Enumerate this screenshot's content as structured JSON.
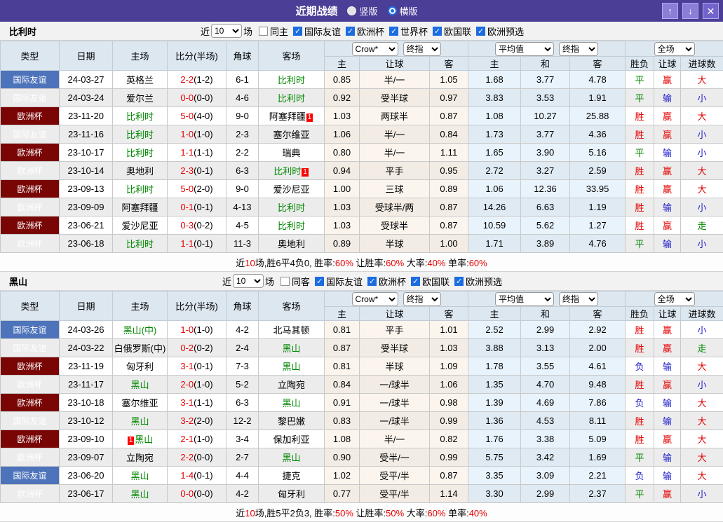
{
  "titlebar": {
    "title": "近期战绩",
    "radios": [
      {
        "label": "竖版",
        "selected": false
      },
      {
        "label": "横版",
        "selected": true
      }
    ],
    "buttons": {
      "up": "↑",
      "down": "↓",
      "close": "✕"
    }
  },
  "filter": {
    "near": "近",
    "count": "10",
    "matches": "场"
  },
  "headers": {
    "type": "类型",
    "date": "日期",
    "home": "主场",
    "score": "比分(半场)",
    "corner": "角球",
    "away": "客场",
    "crow": "Crow*",
    "final1": "终指",
    "avg": "平均值",
    "final2": "终指",
    "full": "全场",
    "sub": [
      "主",
      "让球",
      "客",
      "主",
      "和",
      "客",
      "胜负",
      "让球",
      "进球数"
    ]
  },
  "colors": {
    "titlebar_bg": "#4b3e97",
    "league_friendly": "#4d73bb",
    "league_euro": "#7a0505",
    "team_highlight_green": "#008800",
    "win_red": "#e60000",
    "lose_blue": "#2222cc",
    "checkbox_blue": "#1b6ce0",
    "header_bg": "#dde7f0",
    "crow_col_bg": "#fbf5ee",
    "avg_col_bg": "#e9f3fb"
  },
  "sections": [
    {
      "team": "比利时",
      "same_label": "同主",
      "same_checked": false,
      "leagues": [
        {
          "label": "国际友谊",
          "checked": true
        },
        {
          "label": "欧洲杯",
          "checked": true
        },
        {
          "label": "世界杯",
          "checked": true
        },
        {
          "label": "欧国联",
          "checked": true
        },
        {
          "label": "欧洲预选",
          "checked": true
        }
      ],
      "rows": [
        {
          "league": "国际友谊",
          "date": "24-03-27",
          "home": {
            "name": "英格兰"
          },
          "score": "2-2",
          "half": "(1-2)",
          "corner": "6-1",
          "away": {
            "name": "比利时",
            "green": true
          },
          "crow": [
            "0.85",
            "半/一",
            "1.05"
          ],
          "avg": [
            "1.68",
            "3.77",
            "4.78"
          ],
          "results": [
            "平",
            "赢",
            "大"
          ]
        },
        {
          "league": "国际友谊",
          "date": "24-03-24",
          "home": {
            "name": "爱尔兰"
          },
          "score": "0-0",
          "half": "(0-0)",
          "corner": "4-6",
          "away": {
            "name": "比利时",
            "green": true
          },
          "crow": [
            "0.92",
            "受半球",
            "0.97"
          ],
          "avg": [
            "3.83",
            "3.53",
            "1.91"
          ],
          "results": [
            "平",
            "输",
            "小"
          ]
        },
        {
          "league": "欧洲杯",
          "date": "23-11-20",
          "home": {
            "name": "比利时",
            "green": true
          },
          "score": "5-0",
          "half": "(4-0)",
          "corner": "9-0",
          "away": {
            "name": "阿塞拜疆",
            "badge": "1",
            "badge_pos": "after"
          },
          "crow": [
            "1.03",
            "两球半",
            "0.87"
          ],
          "avg": [
            "1.08",
            "10.27",
            "25.88"
          ],
          "results": [
            "胜",
            "赢",
            "大"
          ]
        },
        {
          "league": "国际友谊",
          "date": "23-11-16",
          "home": {
            "name": "比利时",
            "green": true
          },
          "score": "1-0",
          "half": "(1-0)",
          "corner": "2-3",
          "away": {
            "name": "塞尔维亚"
          },
          "crow": [
            "1.06",
            "半/一",
            "0.84"
          ],
          "avg": [
            "1.73",
            "3.77",
            "4.36"
          ],
          "results": [
            "胜",
            "赢",
            "小"
          ]
        },
        {
          "league": "欧洲杯",
          "date": "23-10-17",
          "home": {
            "name": "比利时",
            "green": true
          },
          "score": "1-1",
          "half": "(1-1)",
          "corner": "2-2",
          "away": {
            "name": "瑞典"
          },
          "crow": [
            "0.80",
            "半/一",
            "1.11"
          ],
          "avg": [
            "1.65",
            "3.90",
            "5.16"
          ],
          "results": [
            "平",
            "输",
            "小"
          ]
        },
        {
          "league": "欧洲杯",
          "date": "23-10-14",
          "home": {
            "name": "奥地利"
          },
          "score": "2-3",
          "half": "(0-1)",
          "corner": "6-3",
          "away": {
            "name": "比利时",
            "green": true,
            "badge": "1",
            "badge_pos": "after"
          },
          "crow": [
            "0.94",
            "平手",
            "0.95"
          ],
          "avg": [
            "2.72",
            "3.27",
            "2.59"
          ],
          "results": [
            "胜",
            "赢",
            "大"
          ]
        },
        {
          "league": "欧洲杯",
          "date": "23-09-13",
          "home": {
            "name": "比利时",
            "green": true
          },
          "score": "5-0",
          "half": "(2-0)",
          "corner": "9-0",
          "away": {
            "name": "爱沙尼亚"
          },
          "crow": [
            "1.00",
            "三球",
            "0.89"
          ],
          "avg": [
            "1.06",
            "12.36",
            "33.95"
          ],
          "results": [
            "胜",
            "赢",
            "大"
          ]
        },
        {
          "league": "欧洲杯",
          "date": "23-09-09",
          "home": {
            "name": "阿塞拜疆"
          },
          "score": "0-1",
          "half": "(0-1)",
          "corner": "4-13",
          "away": {
            "name": "比利时",
            "green": true
          },
          "crow": [
            "1.03",
            "受球半/两",
            "0.87"
          ],
          "avg": [
            "14.26",
            "6.63",
            "1.19"
          ],
          "results": [
            "胜",
            "输",
            "小"
          ]
        },
        {
          "league": "欧洲杯",
          "date": "23-06-21",
          "home": {
            "name": "爱沙尼亚"
          },
          "score": "0-3",
          "half": "(0-2)",
          "corner": "4-5",
          "away": {
            "name": "比利时",
            "green": true
          },
          "crow": [
            "1.03",
            "受球半",
            "0.87"
          ],
          "avg": [
            "10.59",
            "5.62",
            "1.27"
          ],
          "results": [
            "胜",
            "赢",
            "走"
          ]
        },
        {
          "league": "欧洲杯",
          "date": "23-06-18",
          "home": {
            "name": "比利时",
            "green": true
          },
          "score": "1-1",
          "half": "(0-1)",
          "corner": "11-3",
          "away": {
            "name": "奥地利"
          },
          "crow": [
            "0.89",
            "半球",
            "1.00"
          ],
          "avg": [
            "1.71",
            "3.89",
            "4.76"
          ],
          "results": [
            "平",
            "输",
            "小"
          ]
        }
      ],
      "summary": [
        {
          "t": "近"
        },
        {
          "t": "10",
          "red": true
        },
        {
          "t": "场,胜6平4负0, 胜率:"
        },
        {
          "t": "60%",
          "red": true
        },
        {
          "t": " 让胜率:"
        },
        {
          "t": "60%",
          "red": true
        },
        {
          "t": " 大率:"
        },
        {
          "t": "40%",
          "red": true
        },
        {
          "t": " 单率:"
        },
        {
          "t": "60%",
          "red": true
        }
      ]
    },
    {
      "team": "黑山",
      "same_label": "同客",
      "same_checked": false,
      "leagues": [
        {
          "label": "国际友谊",
          "checked": true
        },
        {
          "label": "欧洲杯",
          "checked": true
        },
        {
          "label": "欧国联",
          "checked": true
        },
        {
          "label": "欧洲预选",
          "checked": true
        }
      ],
      "rows": [
        {
          "league": "国际友谊",
          "date": "24-03-26",
          "home": {
            "name": "黑山(中)",
            "green": true
          },
          "score": "1-0",
          "half": "(1-0)",
          "corner": "4-2",
          "away": {
            "name": "北马其顿"
          },
          "crow": [
            "0.81",
            "平手",
            "1.01"
          ],
          "avg": [
            "2.52",
            "2.99",
            "2.92"
          ],
          "results": [
            "胜",
            "赢",
            "小"
          ]
        },
        {
          "league": "国际友谊",
          "date": "24-03-22",
          "home": {
            "name": "白俄罗斯(中)"
          },
          "score": "0-2",
          "half": "(0-2)",
          "corner": "2-4",
          "away": {
            "name": "黑山",
            "green": true
          },
          "crow": [
            "0.87",
            "受半球",
            "1.03"
          ],
          "avg": [
            "3.88",
            "3.13",
            "2.00"
          ],
          "results": [
            "胜",
            "赢",
            "走"
          ]
        },
        {
          "league": "欧洲杯",
          "date": "23-11-19",
          "home": {
            "name": "匈牙利"
          },
          "score": "3-1",
          "half": "(0-1)",
          "corner": "7-3",
          "away": {
            "name": "黑山",
            "green": true
          },
          "crow": [
            "0.81",
            "半球",
            "1.09"
          ],
          "avg": [
            "1.78",
            "3.55",
            "4.61"
          ],
          "results": [
            "负",
            "输",
            "大"
          ]
        },
        {
          "league": "欧洲杯",
          "date": "23-11-17",
          "home": {
            "name": "黑山",
            "green": true
          },
          "score": "2-0",
          "half": "(1-0)",
          "corner": "5-2",
          "away": {
            "name": "立陶宛"
          },
          "crow": [
            "0.84",
            "一/球半",
            "1.06"
          ],
          "avg": [
            "1.35",
            "4.70",
            "9.48"
          ],
          "results": [
            "胜",
            "赢",
            "小"
          ]
        },
        {
          "league": "欧洲杯",
          "date": "23-10-18",
          "home": {
            "name": "塞尔维亚"
          },
          "score": "3-1",
          "half": "(1-1)",
          "corner": "6-3",
          "away": {
            "name": "黑山",
            "green": true
          },
          "crow": [
            "0.91",
            "一/球半",
            "0.98"
          ],
          "avg": [
            "1.39",
            "4.69",
            "7.86"
          ],
          "results": [
            "负",
            "输",
            "大"
          ]
        },
        {
          "league": "国际友谊",
          "date": "23-10-12",
          "home": {
            "name": "黑山",
            "green": true
          },
          "score": "3-2",
          "half": "(2-0)",
          "corner": "12-2",
          "away": {
            "name": "黎巴嫩"
          },
          "crow": [
            "0.83",
            "一/球半",
            "0.99"
          ],
          "avg": [
            "1.36",
            "4.53",
            "8.11"
          ],
          "results": [
            "胜",
            "输",
            "大"
          ]
        },
        {
          "league": "欧洲杯",
          "date": "23-09-10",
          "home": {
            "name": "黑山",
            "green": true,
            "badge": "1",
            "badge_pos": "before"
          },
          "score": "2-1",
          "half": "(1-0)",
          "corner": "3-4",
          "away": {
            "name": "保加利亚"
          },
          "crow": [
            "1.08",
            "半/一",
            "0.82"
          ],
          "avg": [
            "1.76",
            "3.38",
            "5.09"
          ],
          "results": [
            "胜",
            "赢",
            "大"
          ]
        },
        {
          "league": "欧洲杯",
          "date": "23-09-07",
          "home": {
            "name": "立陶宛"
          },
          "score": "2-2",
          "half": "(0-0)",
          "corner": "2-7",
          "away": {
            "name": "黑山",
            "green": true
          },
          "crow": [
            "0.90",
            "受半/一",
            "0.99"
          ],
          "avg": [
            "5.75",
            "3.42",
            "1.69"
          ],
          "results": [
            "平",
            "输",
            "大"
          ]
        },
        {
          "league": "国际友谊",
          "date": "23-06-20",
          "home": {
            "name": "黑山",
            "green": true
          },
          "score": "1-4",
          "half": "(0-1)",
          "corner": "4-4",
          "away": {
            "name": "捷克"
          },
          "crow": [
            "1.02",
            "受平/半",
            "0.87"
          ],
          "avg": [
            "3.35",
            "3.09",
            "2.21"
          ],
          "results": [
            "负",
            "输",
            "大"
          ]
        },
        {
          "league": "欧洲杯",
          "date": "23-06-17",
          "home": {
            "name": "黑山",
            "green": true
          },
          "score": "0-0",
          "half": "(0-0)",
          "corner": "4-2",
          "away": {
            "name": "匈牙利"
          },
          "crow": [
            "0.77",
            "受平/半",
            "1.14"
          ],
          "avg": [
            "3.30",
            "2.99",
            "2.37"
          ],
          "results": [
            "平",
            "赢",
            "小"
          ]
        }
      ],
      "summary": [
        {
          "t": "近"
        },
        {
          "t": "10",
          "red": true
        },
        {
          "t": "场,胜5平2负3, 胜率:"
        },
        {
          "t": "50%",
          "red": true
        },
        {
          "t": " 让胜率:"
        },
        {
          "t": "50%",
          "red": true
        },
        {
          "t": " 大率:"
        },
        {
          "t": "60%",
          "red": true
        },
        {
          "t": " 单率:"
        },
        {
          "t": "40%",
          "red": true
        }
      ]
    }
  ]
}
